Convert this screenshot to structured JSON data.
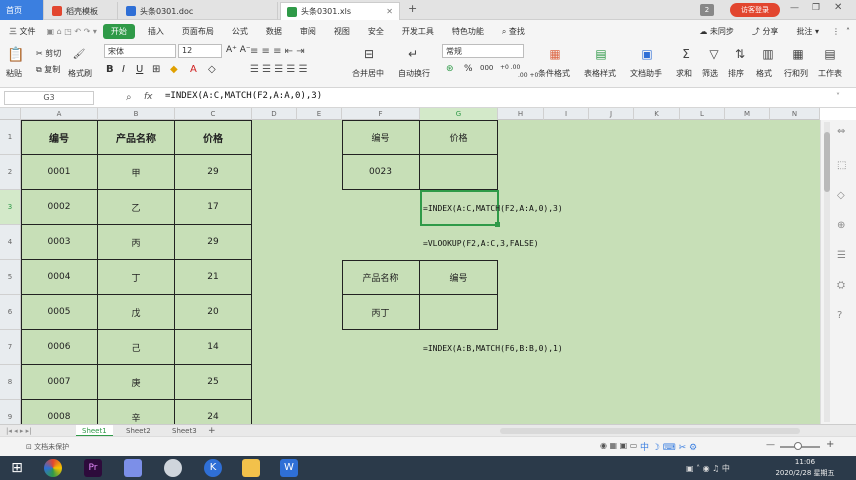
{
  "tabs": {
    "home": "首页",
    "daoke": "稻壳模板",
    "doc": "头条0301.doc",
    "xls": "头条0301.xls",
    "add": "+",
    "badge": "2",
    "login": "访客登录"
  },
  "menu": {
    "file": "三 文件",
    "start": "开始",
    "items": [
      "插入",
      "页面布局",
      "公式",
      "数据",
      "审阅",
      "视图",
      "安全",
      "开发工具",
      "特色功能"
    ],
    "search": "查找",
    "sync": "未同步",
    "share": "分享",
    "comment": "批注"
  },
  "ribbon": {
    "cut": "剪切",
    "copy": "复制",
    "paste": "粘贴",
    "format_painter": "格式刷",
    "font": "宋体",
    "size": "12",
    "merge": "合并居中",
    "wrap": "自动换行",
    "number_format": "常规",
    "cond_format": "条件格式",
    "table_style": "表格样式",
    "doc_helper": "文档助手",
    "sum": "求和",
    "filter": "筛选",
    "sort": "排序",
    "format": "格式",
    "rowcol": "行和列",
    "worksheet": "工作表",
    "percent_symbol": "%",
    "thousands": "000",
    "dec_add": "+0 .00",
    "dec_remove": ".00 +0"
  },
  "formula_bar": {
    "namebox": "G3",
    "fx": "fx",
    "formula": "=INDEX(A:C,MATCH(F2,A:A,0),3)"
  },
  "columns": [
    "A",
    "B",
    "C",
    "D",
    "E",
    "F",
    "G",
    "H",
    "I",
    "J",
    "K",
    "L",
    "M",
    "N"
  ],
  "rows": [
    "1",
    "2",
    "3",
    "4",
    "5",
    "6",
    "7",
    "8",
    "9"
  ],
  "table": {
    "headers": [
      "编号",
      "产品名称",
      "价格"
    ],
    "data": [
      [
        "0001",
        "甲",
        "29"
      ],
      [
        "0002",
        "乙",
        "17"
      ],
      [
        "0003",
        "丙",
        "29"
      ],
      [
        "0004",
        "丁",
        "21"
      ],
      [
        "0005",
        "戊",
        "20"
      ],
      [
        "0006",
        "己",
        "14"
      ],
      [
        "0007",
        "庚",
        "25"
      ],
      [
        "0008",
        "辛",
        "24"
      ]
    ]
  },
  "lookup1": {
    "h1": "编号",
    "h2": "价格",
    "v1": "0023",
    "v2": ""
  },
  "lookup2": {
    "h1": "产品名称",
    "h2": "编号",
    "v1": "丙丁",
    "v2": ""
  },
  "formulas": {
    "f1": "=INDEX(A:C,MATCH(F2,A:A,0),3)",
    "f2": "=VLOOKUP(F2,A:C,3,FALSE)",
    "f3": "=INDEX(A:B,MATCH(F6,B:B,0),1)"
  },
  "sheets": [
    "Sheet1",
    "Sheet2",
    "Sheet3"
  ],
  "status": {
    "protect": "文档未保护",
    "zoom_minus": "—",
    "zoom_plus": "+"
  },
  "clock": {
    "time": "11:06",
    "date": "2020/2/28 星期五"
  }
}
